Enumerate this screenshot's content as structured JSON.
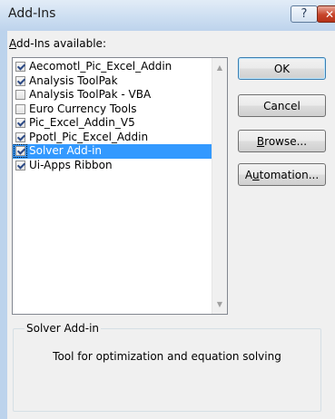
{
  "window": {
    "title": "Add-Ins",
    "help_icon": "?",
    "close_icon": "✕"
  },
  "addins_label": {
    "mnemonic": "A",
    "rest": "dd-Ins available:"
  },
  "list": {
    "items": [
      {
        "label": "Aecomotl_Pic_Excel_Addin",
        "checked": true,
        "selected": false
      },
      {
        "label": "Analysis ToolPak",
        "checked": true,
        "selected": false
      },
      {
        "label": "Analysis ToolPak - VBA",
        "checked": false,
        "selected": false
      },
      {
        "label": "Euro Currency Tools",
        "checked": false,
        "selected": false
      },
      {
        "label": "Pic_Excel_Addin_V5",
        "checked": true,
        "selected": false
      },
      {
        "label": "Ppotl_Pic_Excel_Addin",
        "checked": true,
        "selected": false
      },
      {
        "label": "Solver Add-in",
        "checked": true,
        "selected": true
      },
      {
        "label": "Ui-Apps Ribbon",
        "checked": true,
        "selected": false
      }
    ],
    "scroll_up_icon": "▲",
    "scroll_down_icon": "▼"
  },
  "buttons": {
    "ok": "OK",
    "cancel": "Cancel",
    "browse_mnemonic": "B",
    "browse_rest": "rowse...",
    "automation_pre": "A",
    "automation_mnemonic": "u",
    "automation_rest": "tomation..."
  },
  "details": {
    "title": "Solver Add-in",
    "description": "Tool for optimization and equation solving"
  },
  "colors": {
    "selection": "#3399ff",
    "dialog_bg": "#f0f0f0",
    "frame": "#bcd3ec",
    "close_button": "#c7442a"
  }
}
